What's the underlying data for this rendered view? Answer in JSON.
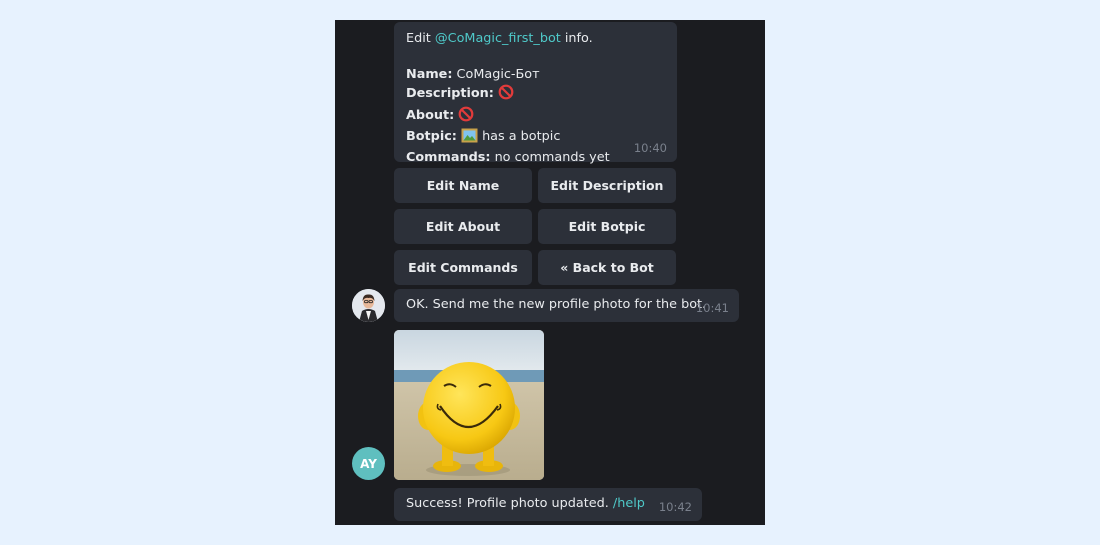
{
  "chat": {
    "info_message": {
      "prefix": "Edit ",
      "bot_link": "@CoMagic_first_bot",
      "suffix": " info.",
      "name_label": "Name:",
      "name_value": " CoMagic-Бот",
      "description_label": "Description:",
      "about_label": "About:",
      "botpic_label": "Botpic:",
      "botpic_value": " has a botpic",
      "commands_label": "Commands:",
      "commands_value": " no commands yet",
      "time": "10:40",
      "prohibited_icon": "prohibited-icon",
      "picture_icon": "framed-picture-icon"
    },
    "keyboard": [
      {
        "label": "Edit Name"
      },
      {
        "label": "Edit Description"
      },
      {
        "label": "Edit About"
      },
      {
        "label": "Edit Botpic"
      },
      {
        "label": "Edit Commands"
      },
      {
        "label": "« Back to Bot"
      }
    ],
    "bot_reply": {
      "text": "OK. Send me the new profile photo for the bot.",
      "time": "10:41"
    },
    "user": {
      "avatar_initials": "AY"
    },
    "success_message": {
      "text": "Success! Profile photo updated. ",
      "link": "/help",
      "time": "10:42"
    },
    "colors": {
      "page_background": "#e7f2fe",
      "chat_background": "#1b1c20",
      "bubble": "#2c3039",
      "link": "#4fc9c9",
      "avatar_ay": "#5fbfbf"
    }
  }
}
